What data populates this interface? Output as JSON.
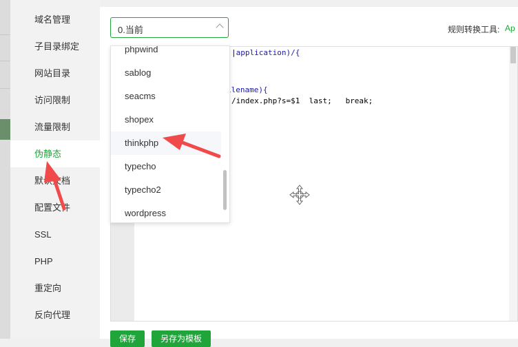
{
  "sidebar": {
    "items": [
      {
        "label": "域名管理"
      },
      {
        "label": "子目录绑定"
      },
      {
        "label": "网站目录"
      },
      {
        "label": "访问限制"
      },
      {
        "label": "流量限制"
      },
      {
        "label": "伪静态",
        "active": true
      },
      {
        "label": "默认文档"
      },
      {
        "label": "配置文件"
      },
      {
        "label": "SSL"
      },
      {
        "label": "PHP"
      },
      {
        "label": "重定向"
      },
      {
        "label": "反向代理"
      }
    ]
  },
  "rewrite": {
    "selected_template": "0.当前",
    "tool_label": "规则转换工具:",
    "tool_value": "Ap"
  },
  "editor": {
    "lines": [
      "application)/{",
      "ilename){",
      "/index.php?s=$1  last;   break;"
    ]
  },
  "dropdown": {
    "options": [
      {
        "label": "phpwind"
      },
      {
        "label": "sablog"
      },
      {
        "label": "seacms"
      },
      {
        "label": "shopex"
      },
      {
        "label": "thinkphp",
        "hover": true
      },
      {
        "label": "typecho"
      },
      {
        "label": "typecho2"
      },
      {
        "label": "wordpress"
      }
    ]
  },
  "buttons": {
    "save_label": "保存",
    "save_as_template_label": "另存为模板"
  },
  "colors": {
    "accent": "#20a53a",
    "annotation_arrow": "#f04a4a"
  }
}
